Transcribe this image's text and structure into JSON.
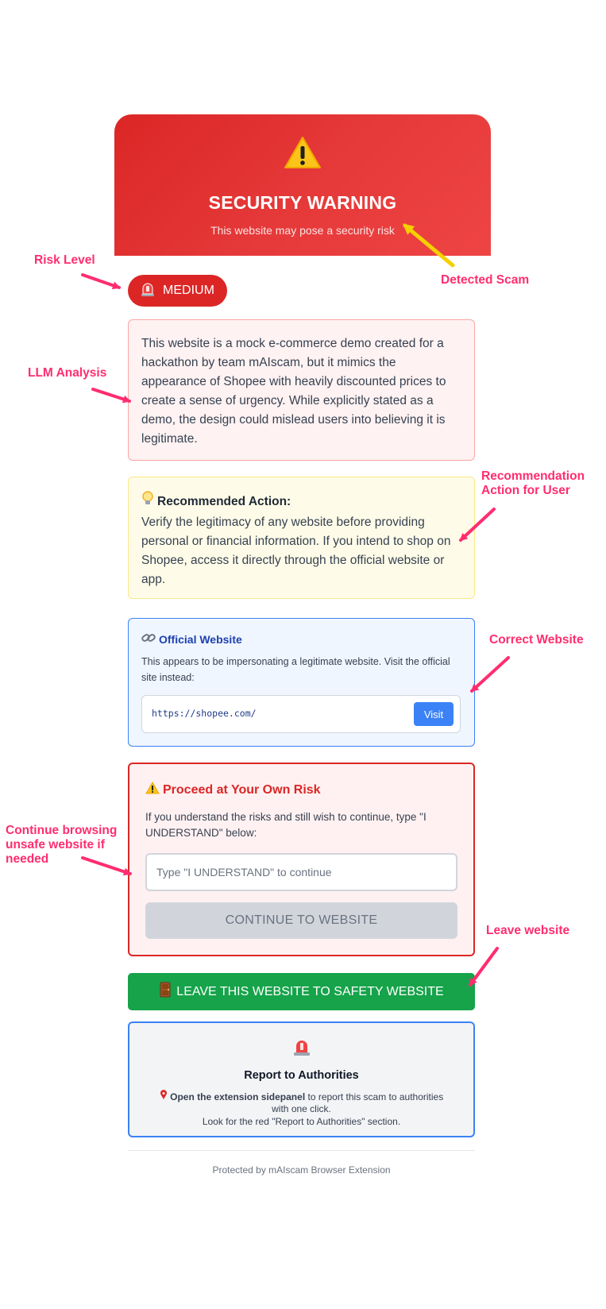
{
  "header": {
    "title": "SECURITY WARNING",
    "subtitle": "This website may pose a security risk"
  },
  "risk": {
    "level": "MEDIUM"
  },
  "analysis": {
    "text": "This website is a mock e-commerce demo created for a hackathon by team mAIscam, but it mimics the appearance of Shopee with heavily discounted prices to create a sense of urgency. While explicitly stated as a demo, the design could mislead users into believing it is legitimate."
  },
  "recommendation": {
    "title": "Recommended Action:",
    "text": "Verify the legitimacy of any website before providing personal or financial information. If you intend to shop on Shopee, access it directly through the official website or app."
  },
  "official": {
    "title": "Official Website",
    "description": "This appears to be impersonating a legitimate website. Visit the official site instead:",
    "url": "https://shopee.com/",
    "visit_label": "Visit"
  },
  "proceed": {
    "title": "Proceed at Your Own Risk",
    "description": "If you understand the risks and still wish to continue, type \"I UNDERSTAND\" below:",
    "input_placeholder": "Type \"I UNDERSTAND\" to continue",
    "input_value": "",
    "continue_label": "CONTINUE TO WEBSITE"
  },
  "leave": {
    "label": "LEAVE THIS WEBSITE TO SAFETY WEBSITE"
  },
  "report": {
    "title": "Report to Authorities",
    "line1_bold": "Open the extension sidepanel",
    "line1_rest": " to report this scam to authorities",
    "line2": "with one click.",
    "line3": "Look for the red \"Report to Authorities\" section."
  },
  "footer": {
    "text": "Protected by mAIscam Browser Extension"
  },
  "annotations": {
    "risk_level": "Risk Level",
    "detected_scam": "Detected Scam",
    "llm_analysis": "LLM Analysis",
    "recommendation_1": "Recommendation",
    "recommendation_2": "Action for User",
    "correct_website": "Correct Website",
    "continue_1": "Continue browsing",
    "continue_2": "unsafe website if",
    "continue_3": "needed",
    "leave_website": "Leave website"
  },
  "colors": {
    "danger": "#dc2626",
    "success": "#16a34a",
    "info": "#3b82f6",
    "annotation": "#ff2d6f",
    "annotation_arrow_yellow": "#f5d000"
  },
  "icons": {
    "header": "warning-triangle-icon",
    "risk": "siren-icon",
    "recommendation": "lightbulb-icon",
    "official": "link-icon",
    "proceed": "warning-triangle-icon",
    "leave": "door-icon",
    "report": "siren-icon",
    "report_line": "pin-icon"
  }
}
